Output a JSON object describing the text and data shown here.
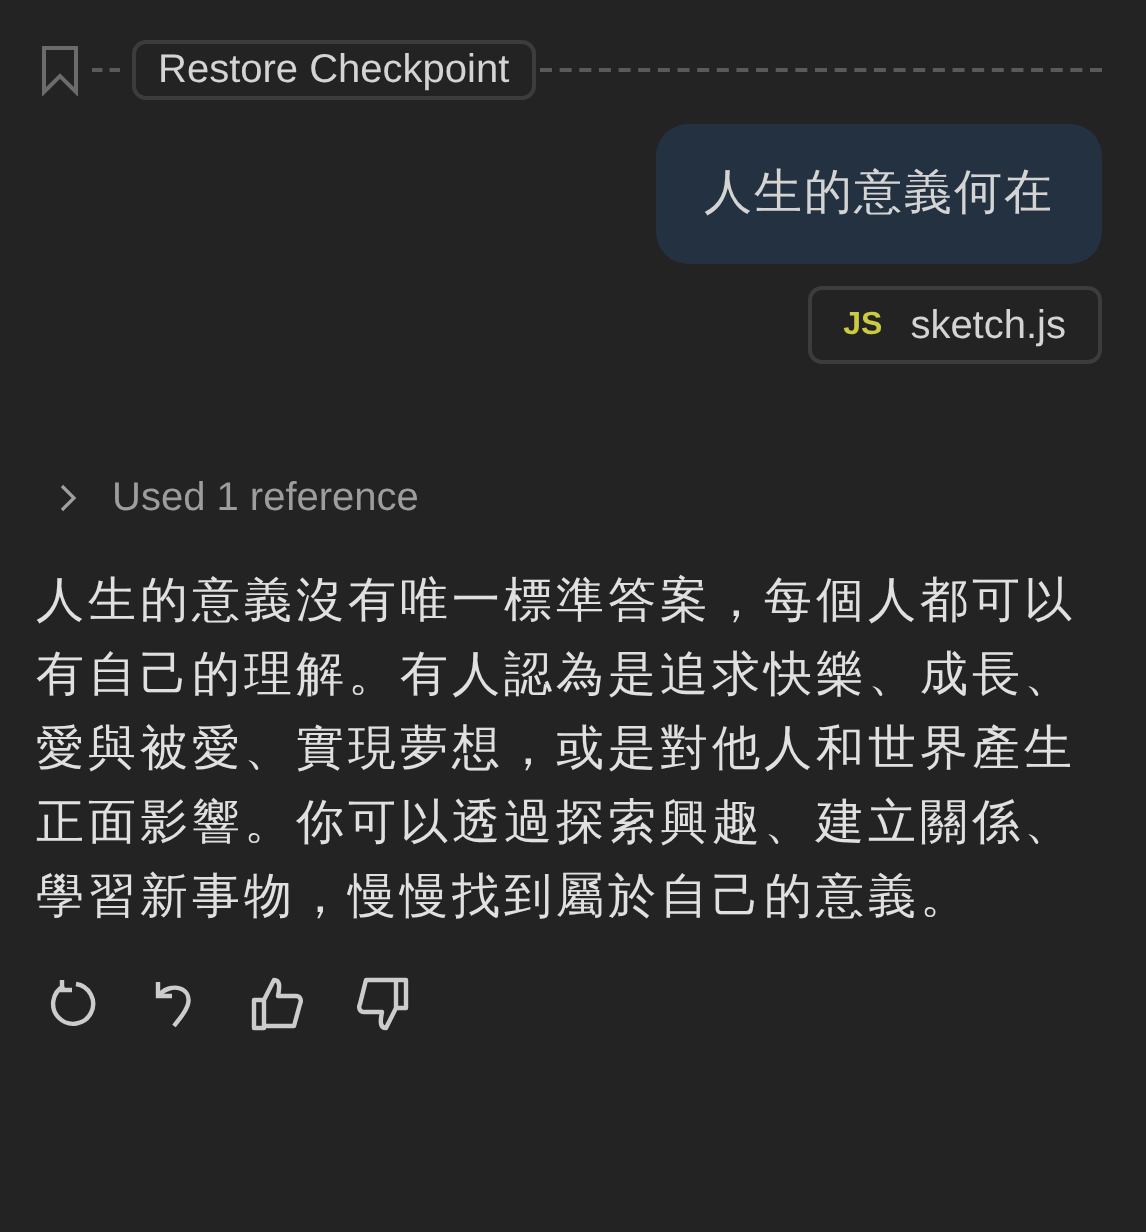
{
  "checkpoint": {
    "label": "Restore Checkpoint"
  },
  "user_message": {
    "text": "人生的意義何在"
  },
  "attachment": {
    "badge": "JS",
    "name": "sketch.js"
  },
  "references": {
    "label": "Used 1 reference",
    "expanded": false
  },
  "answer": {
    "text": "人生的意義沒有唯一標準答案，每個人都可以有自己的理解。有人認為是追求快樂、成長、愛與被愛、實現夢想，或是對他人和世界產生正面影響。你可以透過探索興趣、建立關係、學習新事物，慢慢找到屬於自己的意義。"
  }
}
